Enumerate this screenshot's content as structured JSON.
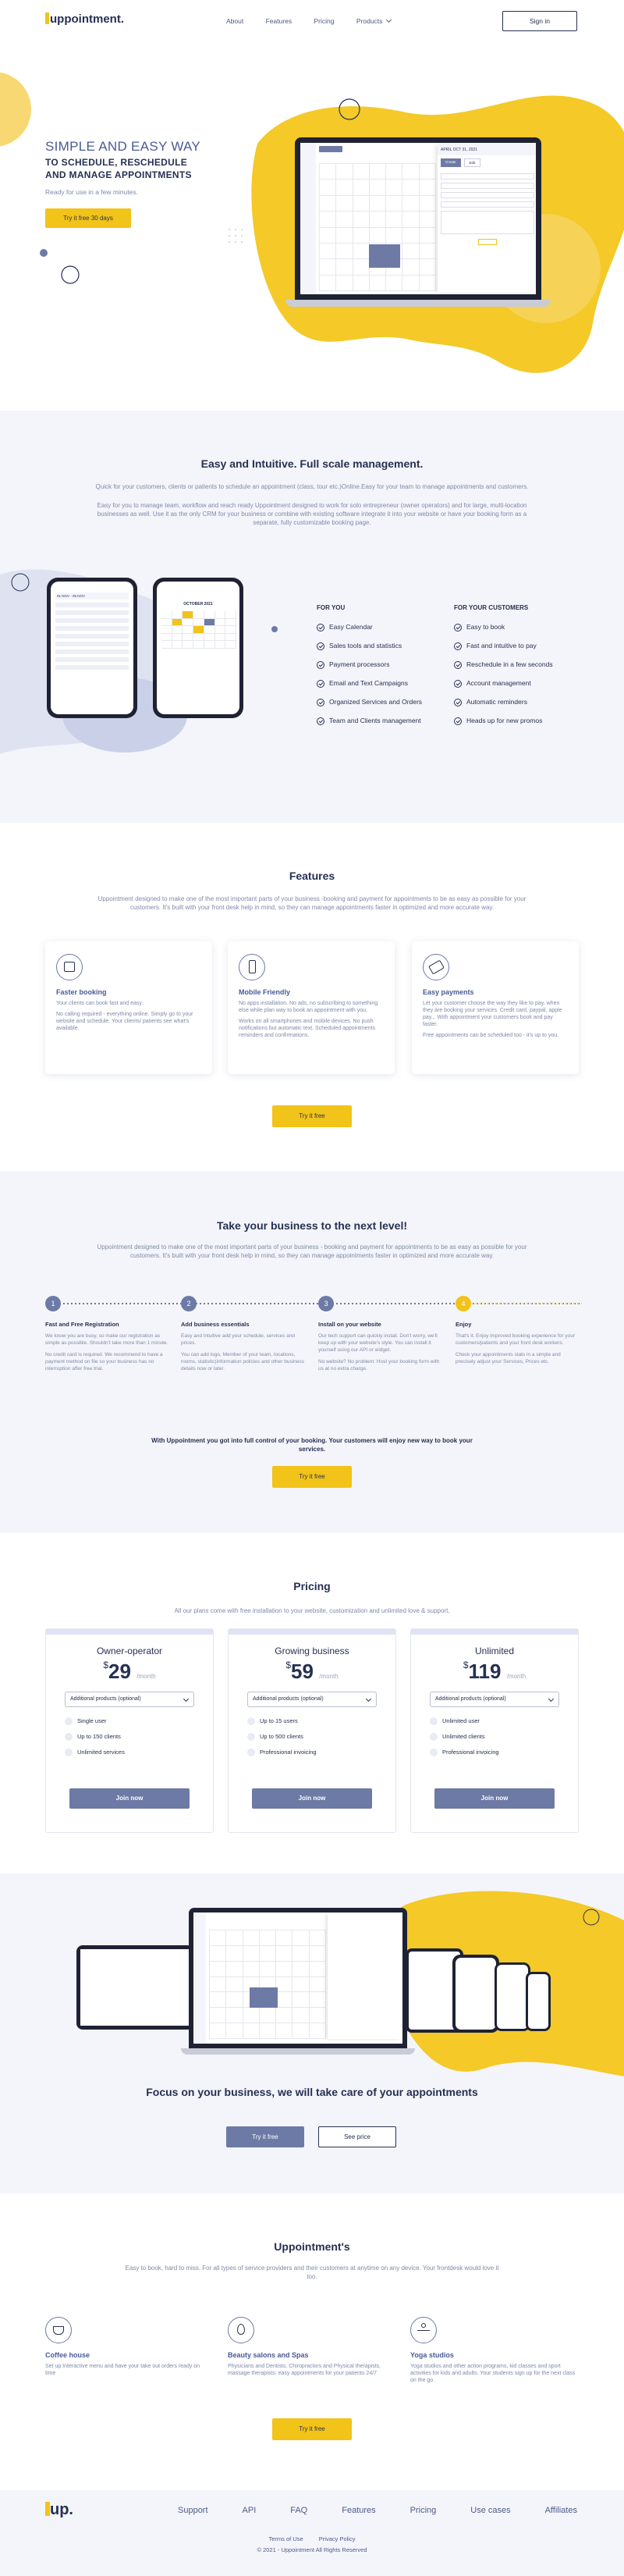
{
  "colors": {
    "accent": "#f2c318",
    "navy": "#263052",
    "slate": "#6d7aa6",
    "muted": "#7d8aa8",
    "tint": "#f4f5fb"
  },
  "nav": {
    "logo": "uppointment.",
    "links": [
      "About",
      "Features",
      "Pricing",
      "Products"
    ],
    "signin": "Sign in"
  },
  "hero": {
    "title_line1": "SIMPLE AND EASY WAY",
    "title_line2": "TO SCHEDULE, RESCHEDULE",
    "title_line3": "AND MANAGE APPOINTMENTS",
    "subtitle": "Ready for use in a few minutes.",
    "cta": "Try it free 30 days"
  },
  "intro": {
    "title": "Easy and Intuitive. Full scale management.",
    "para1": "Quick for your customers, clients or patients to schedule an appointment (class, tour etc.)Online.Easy for your team to manage appointments and customers.",
    "para2": "Easy for you to manage team, workflow and reach ready Uppointment designed to work for solo entrepreneur (owner operators) and for large, multi-location businesses as well. Use it as the only CRM for your business or combine with existing software integrate it into your website or have your booking form as a separate, fully customizable booking page.",
    "for_you_title": "FOR YOU",
    "for_you": [
      "Easy Calendar",
      "Sales tools and statistics",
      "Payment processors",
      "Email and Text Campaigns",
      "Organized Services and Orders",
      "Team and Clients management"
    ],
    "for_customers_title": "FOR YOUR CUSTOMERS",
    "for_customers": [
      "Easy to book",
      "Fast and intuitive to pay",
      "Reschedule in a few seconds",
      "Account management",
      "Automatic reminders",
      "Heads up for new promos"
    ],
    "phone_month": "OCTOBER 2021"
  },
  "features": {
    "title": "Features",
    "lead": "Uppointment designed to make one of the most important parts of your business -booking and payment for appointments to be as easy as possible for your customers. It's built with your front desk help in mind, so they can manage appointments faster in optimized and more accurate way.",
    "cards": [
      {
        "title": "Faster booking",
        "p1": "Your clients can book fast and easy.",
        "p2": "No calling required - everything online. Simply go to your website and schedule. Your clients/ patients see what's available."
      },
      {
        "title": "Mobile Friendly",
        "p1": "No apps installation. No ads, no subscribing to something else while plan way to book an appointment with you.",
        "p2": "Works on all smartphones and mobile devices. No push notifications but automatic text. Scheduled appointments reminders and confirmations."
      },
      {
        "title": "Easy payments",
        "p1": "Let your customer choose the way they like to pay, when they are booking your services. Credit card, paypal, apple pay... With appointment your customers book and pay faster.",
        "p2": "Free appointments can be scheduled too - it's up to you."
      }
    ],
    "cta": "Try it free"
  },
  "steps": {
    "title": "Take your business to the next level!",
    "lead": "Uppointment designed to make one of the most important parts of your business - booking and payment for appointments to be as easy as possible for your customers. It's built with your front desk help in mind, so they can manage appointments faster in optimized and more accurate way.",
    "items": [
      {
        "num": "1",
        "title": "Fast and Free Registration",
        "p1": "We know you are busy, so make our registration as simple as possible. Shouldn't take more than 1 minute.",
        "p2": "No credit card is required. We recommend to have a payment method on file so your business has no interruption after free trial."
      },
      {
        "num": "2",
        "title": "Add business essentials",
        "p1": "Easy and intuitive add your schedule, services and prices.",
        "p2": "You can add logo, Member of your team, locations, rooms, statistic(information policies and other business details now or later."
      },
      {
        "num": "3",
        "title": "Install on your website",
        "p1": "Our tech support can quickly install. Don't worry, we'll keep up with your website's style. You can install it yourself using our API or widget.",
        "p2": "No website? No problem: Host your booking form with us at no extra charge."
      },
      {
        "num": "4",
        "title": "Enjoy",
        "p1": "That's it. Enjoy improved booking experience for your customers/patients and your front desk workers.",
        "p2": "Check your appointments stats in a simple and precisely adjust your Services, Prices etc."
      }
    ],
    "bottom": "With Uppointment you got into full control of your booking. Your customers will enjoy new way to book your services.",
    "cta": "Try it free"
  },
  "pricing": {
    "title": "Pricing",
    "lead": "All our plans come with free installation to your website, customization and unlimited love & support.",
    "plans": [
      {
        "name": "Owner-operator",
        "currency": "$",
        "price": "29",
        "period": "/month",
        "select": "Additional products (optional)",
        "items": [
          "Single user",
          "Up to 150 clients",
          "Unlimited services"
        ],
        "cta": "Join now"
      },
      {
        "name": "Growing business",
        "currency": "$",
        "price": "59",
        "period": "/month",
        "select": "Additional products (optional)",
        "items": [
          "Up to 15 users",
          "Up to 500 clients",
          "Professional invoicing"
        ],
        "cta": "Join now"
      },
      {
        "name": "Unlimited",
        "currency": "$",
        "price": "119",
        "period": "/month",
        "select": "Additional products (optional)",
        "items": [
          "Unlimited user",
          "Unlimited clients",
          "Professional invoicing"
        ],
        "cta": "Join now"
      }
    ]
  },
  "focus": {
    "title": "Focus on your business, we will take care of your appointments",
    "cta1": "Try it free",
    "cta2": "See price"
  },
  "industries": {
    "title": "Uppointment's",
    "lead": "Easy to book, hard to miss. For all types of service providers and their customers at anytime on any device. Your frontdesk would love it too.",
    "items": [
      {
        "title": "Coffee house",
        "p": "Set up Interactive menu and have your take out orders ready on time"
      },
      {
        "title": "Beauty salons and Spas",
        "p": "Physicians and Dentists, Chiropractors and Physical therapists, massage therapists: easy appointments for your patients 24/7"
      },
      {
        "title": "Yoga studios",
        "p": "Yoga studios and other action programs, kid classes and sport activities for kids and adults. Your students sign up for the next class on the go."
      }
    ],
    "cta": "Try it free"
  },
  "footer": {
    "logo": "up.",
    "links": [
      "Support",
      "API",
      "FAQ",
      "Features",
      "Pricing",
      "Use cases",
      "Affiliates"
    ],
    "terms": "Terms of Use",
    "privacy": "Privacy Policy",
    "copy": "© 2021 - Uppointment All Rights Reserved"
  },
  "mock": {
    "date": "APRIL OCT 31, 2021",
    "tabs": [
      "Create",
      "Edit"
    ],
    "week": "WEEK"
  }
}
